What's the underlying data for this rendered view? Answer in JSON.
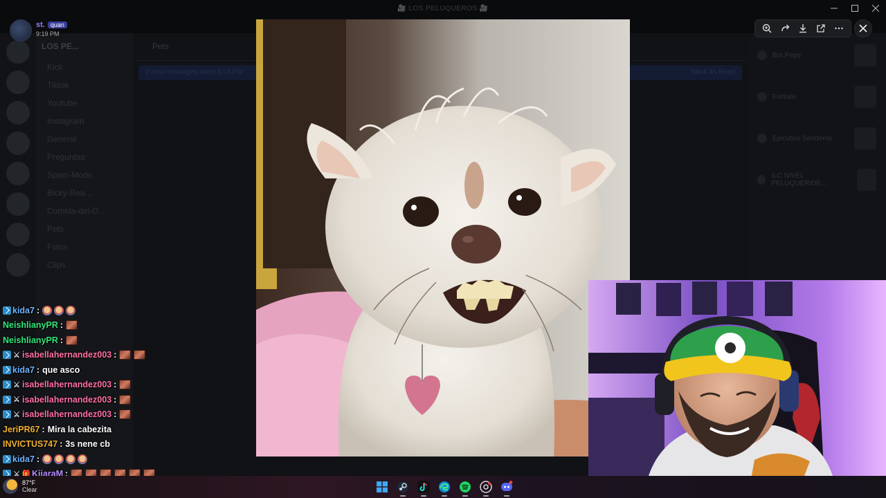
{
  "window": {
    "title": "🎥 LOS PELUQUEROS 🎥",
    "controls": [
      "minimize",
      "maximize",
      "close"
    ]
  },
  "discord_background": {
    "server_name": "LOS PE...",
    "channel_name": "Pets",
    "banner_text": "2 new messages since 5:04 PM",
    "banner_action": "Mark As Read",
    "channels": [
      "Kick",
      "Tiktok",
      "Youtube",
      "Instagram",
      "General",
      "Preguntas",
      "Spam-Mods",
      "Bicky-Rea...",
      "Comida-del-D...",
      "Pets",
      "Fotos",
      "Clips"
    ],
    "members": [
      "Bot Pepe",
      "Fortnite",
      "Ejecutivo Senderos",
      "ILC NIVEL PELUQUERIDE..."
    ]
  },
  "poster": {
    "username": "st.",
    "badge": "quan",
    "timestamp": "9:19 PM"
  },
  "viewer_toolbar": {
    "tools": [
      "zoom-in-icon",
      "rotate-icon",
      "download-icon",
      "open-external-icon",
      "more-icon"
    ]
  },
  "main_image": {
    "subject": "fluffy white dog grinning"
  },
  "chat": [
    {
      "badges": [
        "prime"
      ],
      "user": "kida7",
      "color": "#6fb2ff",
      "message": "",
      "emotes": [
        "face",
        "face",
        "face"
      ]
    },
    {
      "badges": [],
      "user": "NeishlianyPR",
      "color": "#2ee87a",
      "message": "",
      "emotes": [
        "block"
      ]
    },
    {
      "badges": [],
      "user": "NeishlianyPR",
      "color": "#2ee87a",
      "message": "",
      "emotes": [
        "block"
      ]
    },
    {
      "badges": [
        "prime",
        "sword"
      ],
      "user": "isabellahernandez003",
      "color": "#ff6fa5",
      "message": "",
      "emotes": [
        "block",
        "block"
      ]
    },
    {
      "badges": [
        "prime"
      ],
      "user": "kida7",
      "color": "#6fb2ff",
      "message": "que asco",
      "emotes": []
    },
    {
      "badges": [
        "prime",
        "sword"
      ],
      "user": "isabellahernandez003",
      "color": "#ff6fa5",
      "message": "",
      "emotes": [
        "block"
      ]
    },
    {
      "badges": [
        "prime",
        "sword"
      ],
      "user": "isabellahernandez003",
      "color": "#ff6fa5",
      "message": "",
      "emotes": [
        "block"
      ]
    },
    {
      "badges": [
        "prime",
        "sword"
      ],
      "user": "isabellahernandez003",
      "color": "#ff6fa5",
      "message": "",
      "emotes": [
        "block"
      ]
    },
    {
      "badges": [],
      "user": "JeriPR67",
      "color": "#f2b233",
      "message": "Mira la cabezita",
      "emotes": []
    },
    {
      "badges": [],
      "user": "INVICTUS747",
      "color": "#f2b233",
      "message": "3s nene cb",
      "emotes": []
    },
    {
      "badges": [
        "prime"
      ],
      "user": "kida7",
      "color": "#6fb2ff",
      "message": "",
      "emotes": [
        "face",
        "face",
        "face",
        "face"
      ]
    },
    {
      "badges": [
        "prime",
        "sword",
        "gift"
      ],
      "user": "KiiaraM",
      "color": "#b68bff",
      "message": "",
      "emotes": [
        "block",
        "block",
        "block",
        "block",
        "block",
        "block"
      ]
    }
  ],
  "taskbar": {
    "weather": {
      "temp": "87°F",
      "condition": "Clear"
    },
    "apps": [
      "windows-start-icon",
      "steam-icon",
      "tiktok-icon",
      "edge-icon",
      "spotify-icon",
      "chrome-icon",
      "discord-icon"
    ]
  },
  "colors": {
    "accent": "#5865f2",
    "chat_text": "#ffffff"
  }
}
